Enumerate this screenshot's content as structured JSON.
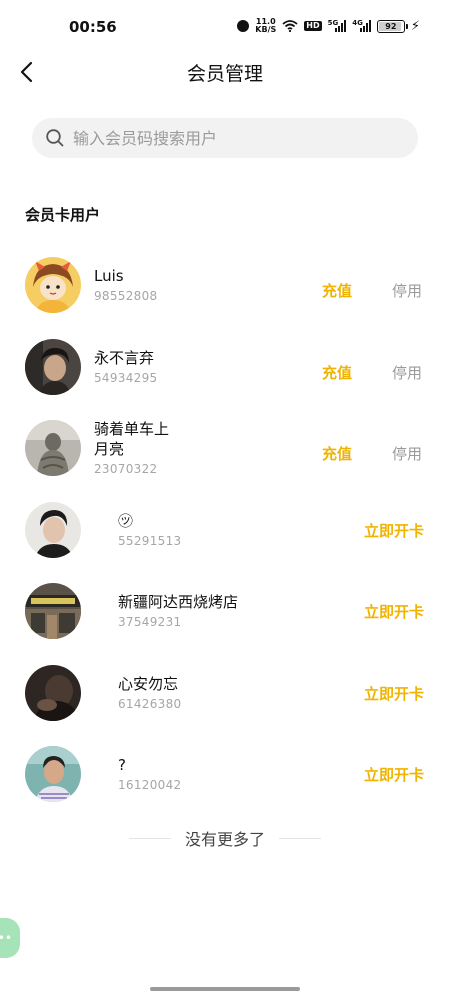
{
  "status_bar": {
    "time": "00:56",
    "net_speed_value": "11.0",
    "net_speed_unit": "KB/S",
    "hd": "HD",
    "gen1": "5G",
    "gen2": "4G",
    "battery": "92",
    "battery_level": 0.92
  },
  "header": {
    "title": "会员管理"
  },
  "search": {
    "placeholder": "输入会员码搜索用户",
    "value": ""
  },
  "section_title": "会员卡用户",
  "members": [
    {
      "name": "Luis",
      "code": "98552808",
      "avatar": "cartoon-girl-avatar",
      "actions": {
        "recharge": "充值",
        "disable": "停用"
      }
    },
    {
      "name": "永不言弃",
      "code": "54934295",
      "avatar": "man-portrait-avatar",
      "actions": {
        "recharge": "充值",
        "disable": "停用"
      }
    },
    {
      "name": "骑着单车上\n月亮",
      "code": "23070322",
      "avatar": "statue-avatar",
      "actions": {
        "recharge": "充值",
        "disable": "停用"
      }
    },
    {
      "name": "㋡",
      "code": "55291513",
      "avatar": "young-man-avatar",
      "actions": {
        "open_card": "立即开卡"
      }
    },
    {
      "name": "新疆阿达西烧烤店",
      "code": "37549231",
      "avatar": "shop-front-avatar",
      "actions": {
        "open_card": "立即开卡"
      }
    },
    {
      "name": "心安勿忘",
      "code": "61426380",
      "avatar": "dark-photo-avatar",
      "actions": {
        "open_card": "立即开卡"
      }
    },
    {
      "name": "?",
      "code": "16120042",
      "avatar": "outdoor-man-avatar",
      "actions": {
        "open_card": "立即开卡"
      }
    }
  ],
  "footer": {
    "no_more": "没有更多了"
  },
  "colors": {
    "accent": "#f0b400",
    "muted": "#9a9a9a",
    "search_bg": "#f2f2f2"
  }
}
